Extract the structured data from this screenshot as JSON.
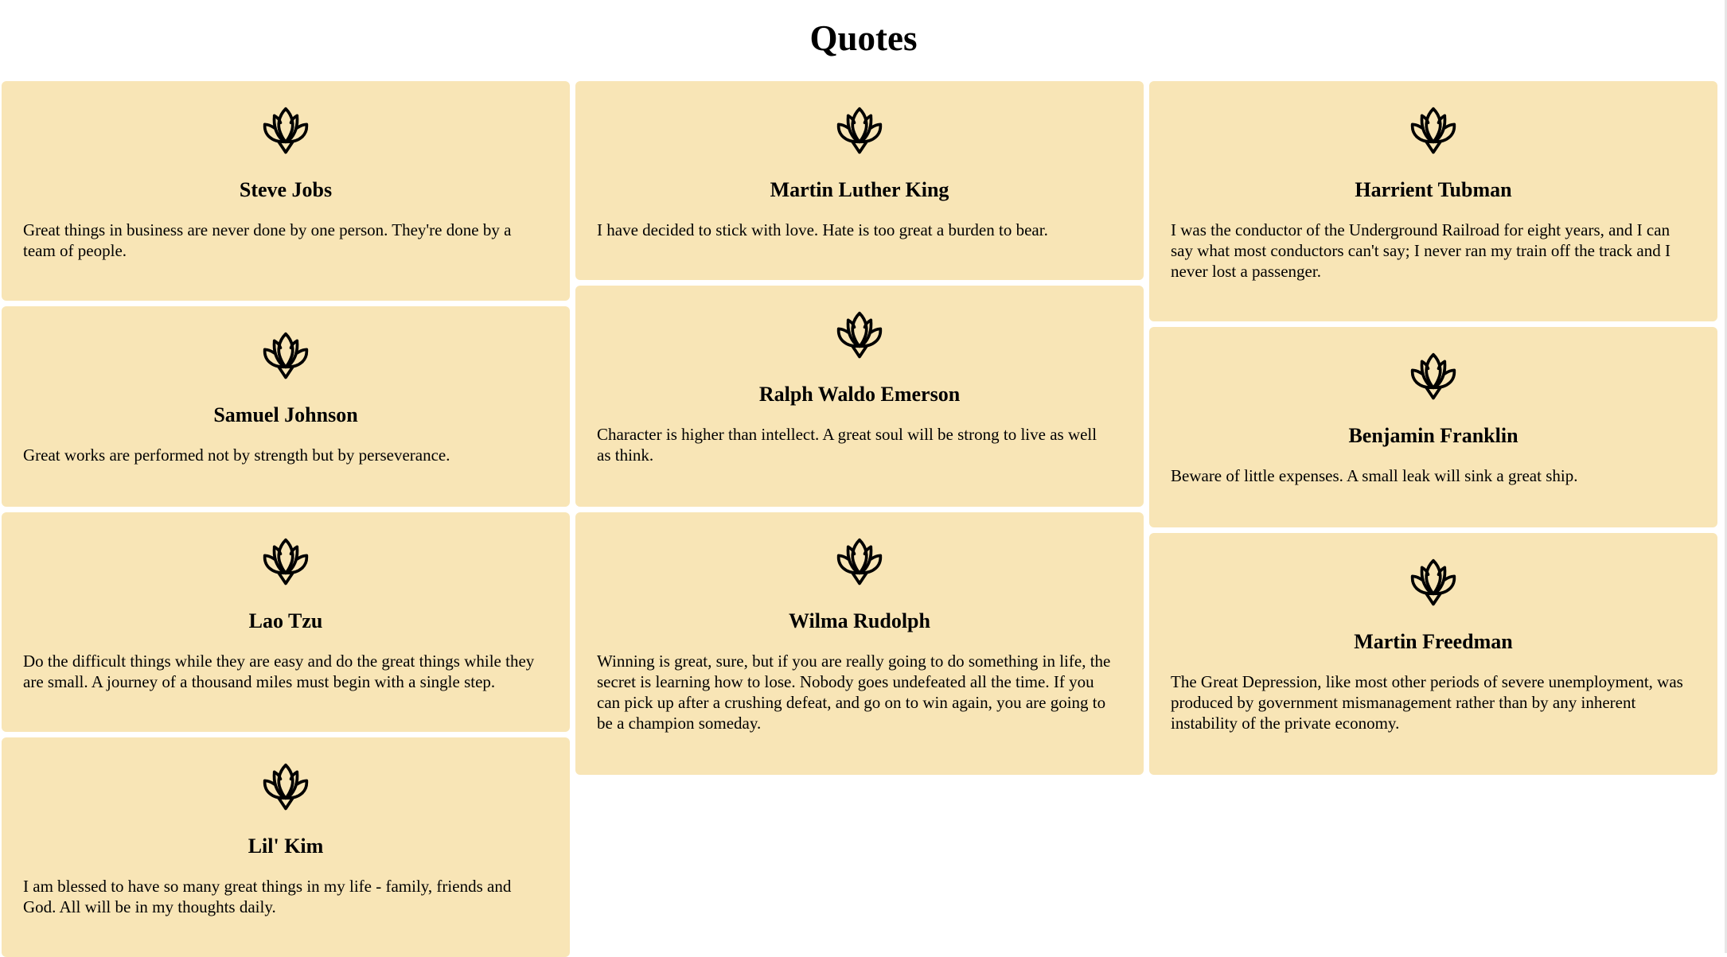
{
  "page": {
    "title": "Quotes"
  },
  "columns": [
    [
      {
        "author": "Steve Jobs",
        "quote": "Great things in business are never done by one person. They're done by a team of people.",
        "icon": "lotus-icon"
      },
      {
        "author": "Samuel Johnson",
        "quote": "Great works are performed not by strength but by perseverance.",
        "icon": "lotus-icon"
      },
      {
        "author": "Lao Tzu",
        "quote": "Do the difficult things while they are easy and do the great things while they are small. A journey of a thousand miles must begin with a single step.",
        "icon": "lotus-icon"
      },
      {
        "author": "Lil' Kim",
        "quote": "I am blessed to have so many great things in my life - family, friends and God. All will be in my thoughts daily.",
        "icon": "lotus-icon"
      }
    ],
    [
      {
        "author": "Martin Luther King",
        "quote": "I have decided to stick with love. Hate is too great a burden to bear.",
        "icon": "lotus-icon"
      },
      {
        "author": "Ralph Waldo Emerson",
        "quote": "Character is higher than intellect. A great soul will be strong to live as well as think.",
        "icon": "lotus-icon"
      },
      {
        "author": "Wilma Rudolph",
        "quote": "Winning is great, sure, but if you are really going to do something in life, the secret is learning how to lose. Nobody goes undefeated all the time. If you can pick up after a crushing defeat, and go on to win again, you are going to be a champion someday.",
        "icon": "lotus-icon"
      }
    ],
    [
      {
        "author": "Harrient Tubman",
        "quote": "I was the conductor of the Underground Railroad for eight years, and I can say what most conductors can't say; I never ran my train off the track and I never lost a passenger.",
        "icon": "lotus-icon"
      },
      {
        "author": "Benjamin Franklin",
        "quote": "Beware of little expenses. A small leak will sink a great ship.",
        "icon": "lotus-icon"
      },
      {
        "author": "Martin Freedman",
        "quote": "The Great Depression, like most other periods of severe unemployment, was produced by government mismanagement rather than by any inherent instability of the private economy.",
        "icon": "lotus-icon"
      }
    ]
  ],
  "colors": {
    "card_bg": "#f8e5b6",
    "page_bg": "#ffffff",
    "text": "#000000"
  }
}
